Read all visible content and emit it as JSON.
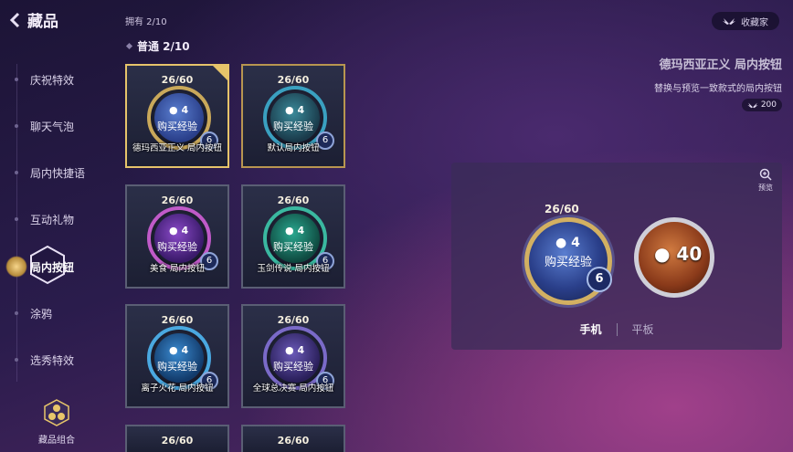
{
  "header": {
    "title": "藏品",
    "owned_label": "拥有 2/10",
    "collector_button": "收藏家"
  },
  "section": {
    "label": "普通 2/10"
  },
  "sidebar": {
    "items": [
      {
        "label": "庆祝特效",
        "active": false
      },
      {
        "label": "聊天气泡",
        "active": false
      },
      {
        "label": "局内快捷语",
        "active": false
      },
      {
        "label": "互动礼物",
        "active": false
      },
      {
        "label": "局内按钮",
        "active": true
      },
      {
        "label": "涂鸦",
        "active": false
      },
      {
        "label": "选秀特效",
        "active": false
      }
    ],
    "combo_label": "藏品组合"
  },
  "cards": [
    {
      "count": "26/60",
      "coin": "4",
      "buy": "购买经验",
      "level": "6",
      "name": "德玛西亚正义  局内按钮",
      "state": "selected",
      "orb_color": "#3f5fb0"
    },
    {
      "count": "26/60",
      "coin": "4",
      "buy": "购买经验",
      "level": "6",
      "name": "默认局内按钮",
      "state": "owned",
      "orb_color": "#2f6a7a"
    },
    {
      "count": "26/60",
      "coin": "4",
      "buy": "购买经验",
      "level": "6",
      "name": "美食  局内按钮",
      "state": "normal",
      "orb_color": "#7a3aa8"
    },
    {
      "count": "26/60",
      "coin": "4",
      "buy": "购买经验",
      "level": "6",
      "name": "玉剑传说  局内按钮",
      "state": "normal",
      "orb_color": "#1f8a7a"
    },
    {
      "count": "26/60",
      "coin": "4",
      "buy": "购买经验",
      "level": "6",
      "name": "离子火花  局内按钮",
      "state": "normal",
      "orb_color": "#2f7ab0"
    },
    {
      "count": "26/60",
      "coin": "4",
      "buy": "购买经验",
      "level": "6",
      "name": "全球总决赛  局内按钮",
      "state": "normal",
      "orb_color": "#5a4aa8"
    },
    {
      "count": "26/60"
    },
    {
      "count": "26/60"
    }
  ],
  "detail": {
    "title": "德玛西亚正义  局内按钮",
    "description": "替换与预览一致款式的局内按钮",
    "price": "200",
    "preview_label": "预览",
    "big": {
      "count": "26/60",
      "coin": "4",
      "buy": "购买经验",
      "level": "6"
    },
    "alt": {
      "value": "40"
    },
    "tabs": [
      {
        "label": "手机",
        "active": true
      },
      {
        "label": "平板",
        "active": false
      }
    ]
  }
}
